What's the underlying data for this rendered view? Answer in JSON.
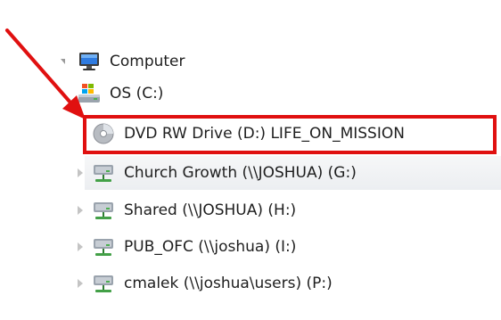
{
  "tree": {
    "root": {
      "label": "Computer",
      "icon": "computer-monitor-icon"
    },
    "drives": [
      {
        "label": "OS (C:)",
        "icon": "windows-drive-icon"
      },
      {
        "label": "DVD RW Drive (D:) LIFE_ON_MISSION",
        "icon": "dvd-disc-icon"
      },
      {
        "label": "Church Growth (\\\\JOSHUA) (G:)",
        "icon": "network-drive-icon"
      },
      {
        "label": "Shared (\\\\JOSHUA) (H:)",
        "icon": "network-drive-icon"
      },
      {
        "label": "PUB_OFC (\\\\joshua) (I:)",
        "icon": "network-drive-icon"
      },
      {
        "label": "cmalek (\\\\joshua\\users) (P:)",
        "icon": "network-drive-icon"
      }
    ]
  },
  "annotation": {
    "highlighted_item": "DVD RW Drive (D:) LIFE_ON_MISSION",
    "color": "#e01010"
  },
  "colors": {
    "selected_row": "#eceef1",
    "text": "#1e1e1e",
    "annotation": "#e01010"
  }
}
